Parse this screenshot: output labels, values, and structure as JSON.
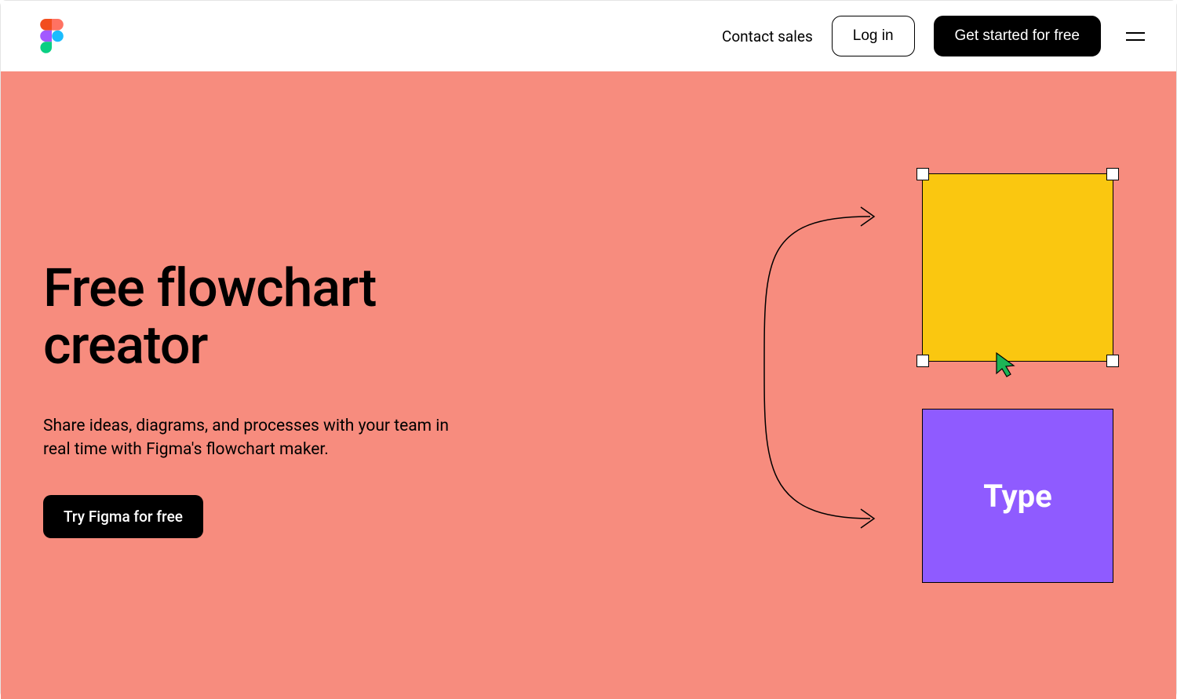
{
  "header": {
    "contact_label": "Contact sales",
    "login_label": "Log in",
    "signup_label": "Get started for free"
  },
  "hero": {
    "title": "Free flowchart creator",
    "subtitle": "Share ideas, diagrams, and processes with your team in real time with Figma's flowchart maker.",
    "cta_label": "Try Figma for free"
  },
  "illustration": {
    "purple_box_label": "Type"
  },
  "colors": {
    "hero_bg": "#F78C7E",
    "yellow": "#FAC710",
    "purple": "#8F5BFF",
    "cursor_green": "#1DB456"
  }
}
